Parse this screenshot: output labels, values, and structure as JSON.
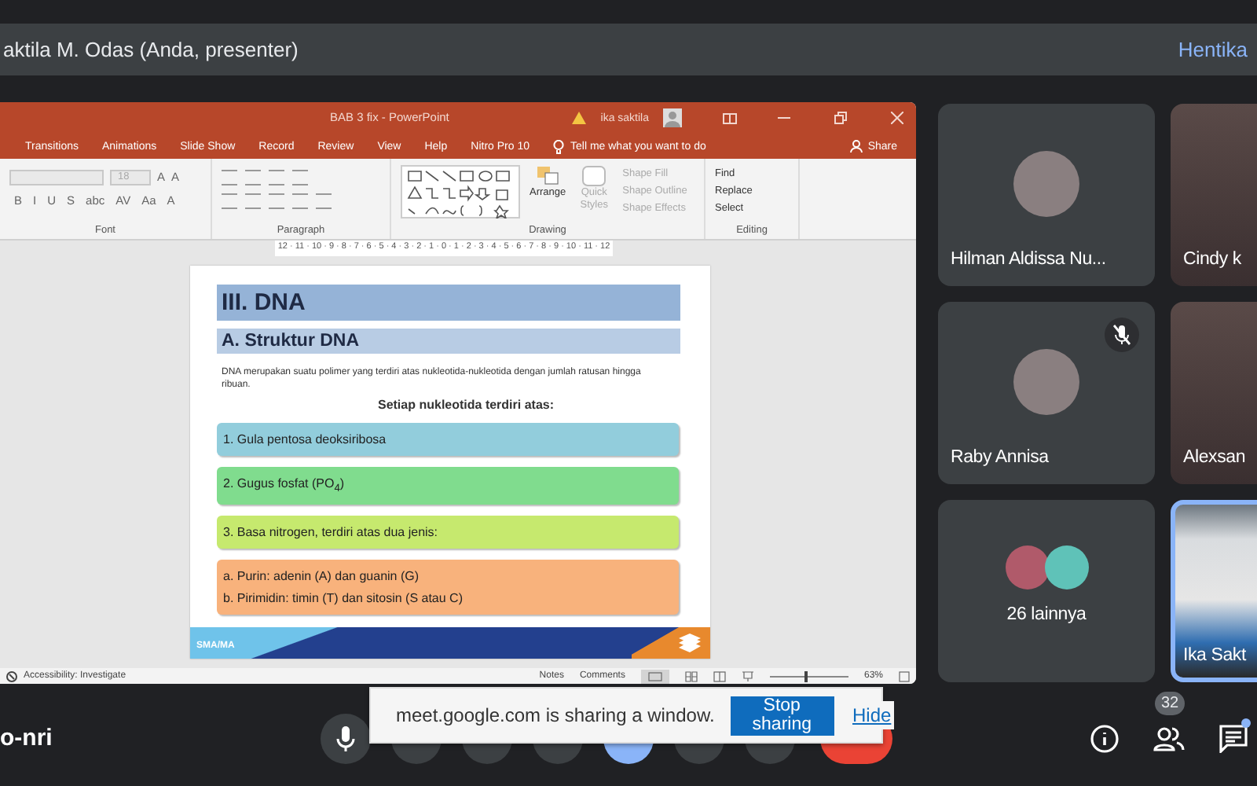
{
  "presenter_bar": {
    "text": "aktila M. Odas (Anda, presenter)",
    "stop_link": "Hentika"
  },
  "powerpoint": {
    "title": "BAB 3 fix - PowerPoint",
    "user": "ika saktila",
    "tabs": [
      {
        "label": "Transitions",
        "selected": false
      },
      {
        "label": "Animations",
        "selected": false
      },
      {
        "label": "Slide Show",
        "selected": false
      },
      {
        "label": "Record",
        "selected": false
      },
      {
        "label": "Review",
        "selected": false
      },
      {
        "label": "View",
        "selected": false
      },
      {
        "label": "Help",
        "selected": false
      },
      {
        "label": "Nitro Pro 10",
        "selected": false
      }
    ],
    "tell_me": "Tell me what you want to do",
    "share": "Share",
    "font_size": "18",
    "grow_buttons": [
      "A",
      "A"
    ],
    "font_buttons": [
      "B",
      "I",
      "U",
      "S",
      "abc",
      "AV",
      "Aa",
      "A"
    ],
    "groups": [
      "Font",
      "Paragraph",
      "Drawing",
      "Editing"
    ],
    "arrange": "Arrange",
    "quick_styles": "Quick Styles",
    "shape_buttons": [
      "Shape Fill",
      "Shape Outline",
      "Shape Effects"
    ],
    "editing_buttons": [
      "Find",
      "Replace",
      "Select"
    ],
    "ruler": "12 · 11 · 10 · 9 · 8 · 7 · 6 · 5 · 4 · 3 · 2 · 1 · 0 · 1 · 2 · 3 · 4 · 5 · 6 · 7 · 8 · 9 · 10 · 11 · 12",
    "slide": {
      "title": "III. DNA",
      "subtitle": "A. Struktur DNA",
      "paragraph": "DNA merupakan suatu polimer yang terdiri atas nukleotida-nukleotida dengan jumlah ratusan hingga ribuan.",
      "heading": "Setiap nukleotida terdiri atas:",
      "boxes": [
        {
          "color": "#92cddc",
          "lines": [
            "1.  Gula pentosa deoksiribosa"
          ]
        },
        {
          "color": "#80dc8e",
          "lines": [
            "2.  Gugus fosfat (PO$_{4}$)"
          ]
        },
        {
          "color": "#c6e96e",
          "lines": [
            "3.  Basa nitrogen, terdiri atas dua jenis:"
          ]
        },
        {
          "color": "#f8b27c",
          "lines": [
            "a.  Purin: adenin (A) dan guanin (G)",
            "b.  Pirimidin: timin (T) dan sitosin (S atau C)"
          ]
        }
      ],
      "footer": "SMA/MA"
    },
    "status": {
      "accessibility": "Accessibility: Investigate",
      "notes": "Notes",
      "comments": "Comments",
      "zoom": "63%",
      "level": 0.45
    }
  },
  "tiles": [
    {
      "name": "Hilman Aldissa Nu...",
      "kind": "avatar",
      "muted": false,
      "highlighted": false
    },
    {
      "name": "Cindy k",
      "kind": "video",
      "muted": false,
      "highlighted": false
    },
    {
      "name": "Raby Annisa",
      "kind": "avatar",
      "muted": true,
      "highlighted": false
    },
    {
      "name": "Alexsan",
      "kind": "video",
      "muted": false,
      "highlighted": false
    },
    {
      "name": "26 lainnya",
      "kind": "others",
      "muted": false,
      "highlighted": false
    },
    {
      "name": "Ika Sakt",
      "kind": "video",
      "muted": false,
      "highlighted": true
    }
  ],
  "meeting_code": "o-nri",
  "share_banner": {
    "message": "meet.google.com is sharing a window.",
    "stop_button": "Stop sharing",
    "hide_link": "Hide"
  },
  "participants_count": "32"
}
